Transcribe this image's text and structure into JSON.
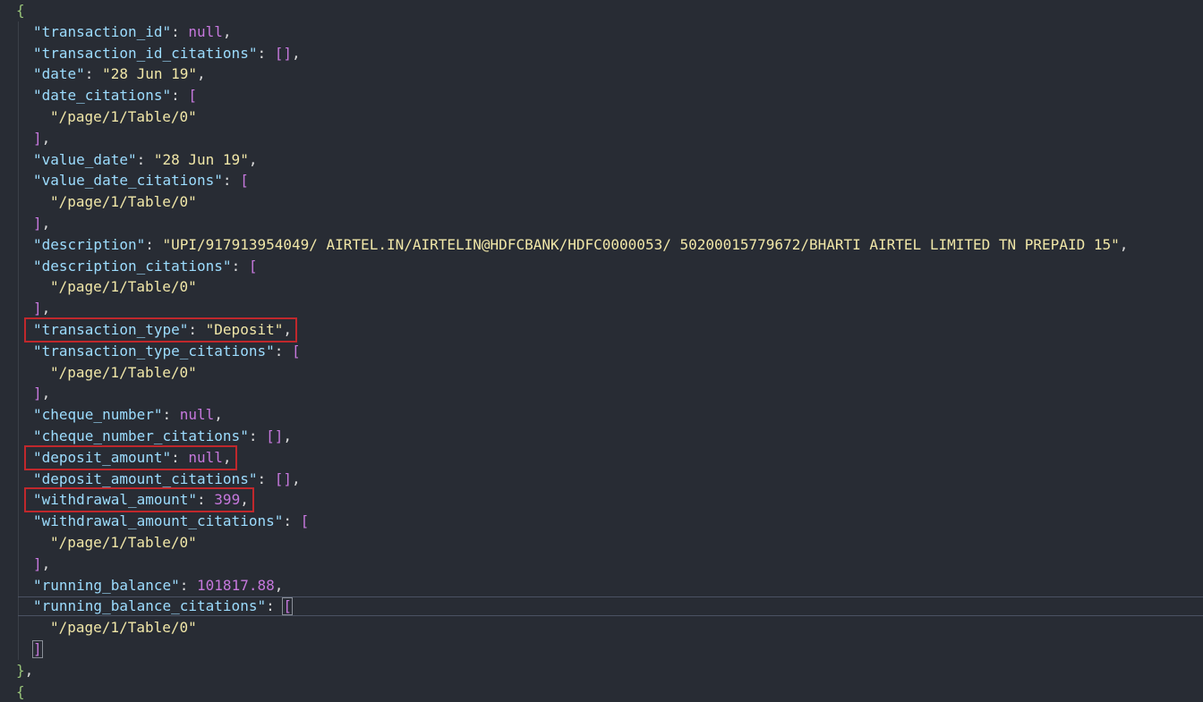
{
  "lines": [
    {
      "indent": 0,
      "tokens": [
        {
          "t": "{",
          "c": "tok-brace"
        }
      ]
    },
    {
      "indent": 1,
      "tokens": [
        {
          "t": "\"transaction_id\"",
          "c": "tok-key"
        },
        {
          "t": ": ",
          "c": "tok-punct"
        },
        {
          "t": "null",
          "c": "tok-null"
        },
        {
          "t": ",",
          "c": "tok-punct"
        }
      ]
    },
    {
      "indent": 1,
      "tokens": [
        {
          "t": "\"transaction_id_citations\"",
          "c": "tok-key"
        },
        {
          "t": ": ",
          "c": "tok-punct"
        },
        {
          "t": "[]",
          "c": "tok-bracket"
        },
        {
          "t": ",",
          "c": "tok-punct"
        }
      ]
    },
    {
      "indent": 1,
      "tokens": [
        {
          "t": "\"date\"",
          "c": "tok-key"
        },
        {
          "t": ": ",
          "c": "tok-punct"
        },
        {
          "t": "\"28 Jun 19\"",
          "c": "tok-str"
        },
        {
          "t": ",",
          "c": "tok-punct"
        }
      ]
    },
    {
      "indent": 1,
      "tokens": [
        {
          "t": "\"date_citations\"",
          "c": "tok-key"
        },
        {
          "t": ": ",
          "c": "tok-punct"
        },
        {
          "t": "[",
          "c": "tok-bracket"
        }
      ]
    },
    {
      "indent": 2,
      "tokens": [
        {
          "t": "\"/page/1/Table/0\"",
          "c": "tok-str"
        }
      ]
    },
    {
      "indent": 1,
      "tokens": [
        {
          "t": "]",
          "c": "tok-bracket"
        },
        {
          "t": ",",
          "c": "tok-punct"
        }
      ]
    },
    {
      "indent": 1,
      "tokens": [
        {
          "t": "\"value_date\"",
          "c": "tok-key"
        },
        {
          "t": ": ",
          "c": "tok-punct"
        },
        {
          "t": "\"28 Jun 19\"",
          "c": "tok-str"
        },
        {
          "t": ",",
          "c": "tok-punct"
        }
      ]
    },
    {
      "indent": 1,
      "tokens": [
        {
          "t": "\"value_date_citations\"",
          "c": "tok-key"
        },
        {
          "t": ": ",
          "c": "tok-punct"
        },
        {
          "t": "[",
          "c": "tok-bracket"
        }
      ]
    },
    {
      "indent": 2,
      "tokens": [
        {
          "t": "\"/page/1/Table/0\"",
          "c": "tok-str"
        }
      ]
    },
    {
      "indent": 1,
      "tokens": [
        {
          "t": "]",
          "c": "tok-bracket"
        },
        {
          "t": ",",
          "c": "tok-punct"
        }
      ]
    },
    {
      "indent": 1,
      "tokens": [
        {
          "t": "\"description\"",
          "c": "tok-key"
        },
        {
          "t": ": ",
          "c": "tok-punct"
        },
        {
          "t": "\"UPI/917913954049/ AIRTEL.IN/AIRTELIN@HDFCBANK/HDFC0000053/ 50200015779672/BHARTI AIRTEL LIMITED TN PREPAID 15\"",
          "c": "tok-str"
        },
        {
          "t": ",",
          "c": "tok-punct"
        }
      ]
    },
    {
      "indent": 1,
      "tokens": [
        {
          "t": "\"description_citations\"",
          "c": "tok-key"
        },
        {
          "t": ": ",
          "c": "tok-punct"
        },
        {
          "t": "[",
          "c": "tok-bracket"
        }
      ]
    },
    {
      "indent": 2,
      "tokens": [
        {
          "t": "\"/page/1/Table/0\"",
          "c": "tok-str"
        }
      ]
    },
    {
      "indent": 1,
      "tokens": [
        {
          "t": "]",
          "c": "tok-bracket"
        },
        {
          "t": ",",
          "c": "tok-punct"
        }
      ]
    },
    {
      "indent": 1,
      "tokens": [
        {
          "t": "\"transaction_type\"",
          "c": "tok-key"
        },
        {
          "t": ": ",
          "c": "tok-punct"
        },
        {
          "t": "\"Deposit\"",
          "c": "tok-str"
        },
        {
          "t": ",",
          "c": "tok-punct"
        }
      ]
    },
    {
      "indent": 1,
      "tokens": [
        {
          "t": "\"transaction_type_citations\"",
          "c": "tok-key"
        },
        {
          "t": ": ",
          "c": "tok-punct"
        },
        {
          "t": "[",
          "c": "tok-bracket"
        }
      ]
    },
    {
      "indent": 2,
      "tokens": [
        {
          "t": "\"/page/1/Table/0\"",
          "c": "tok-str"
        }
      ]
    },
    {
      "indent": 1,
      "tokens": [
        {
          "t": "]",
          "c": "tok-bracket"
        },
        {
          "t": ",",
          "c": "tok-punct"
        }
      ]
    },
    {
      "indent": 1,
      "tokens": [
        {
          "t": "\"cheque_number\"",
          "c": "tok-key"
        },
        {
          "t": ": ",
          "c": "tok-punct"
        },
        {
          "t": "null",
          "c": "tok-null"
        },
        {
          "t": ",",
          "c": "tok-punct"
        }
      ]
    },
    {
      "indent": 1,
      "tokens": [
        {
          "t": "\"cheque_number_citations\"",
          "c": "tok-key"
        },
        {
          "t": ": ",
          "c": "tok-punct"
        },
        {
          "t": "[]",
          "c": "tok-bracket"
        },
        {
          "t": ",",
          "c": "tok-punct"
        }
      ]
    },
    {
      "indent": 1,
      "tokens": [
        {
          "t": "\"deposit_amount\"",
          "c": "tok-key"
        },
        {
          "t": ": ",
          "c": "tok-punct"
        },
        {
          "t": "null",
          "c": "tok-null"
        },
        {
          "t": ",",
          "c": "tok-punct"
        }
      ]
    },
    {
      "indent": 1,
      "tokens": [
        {
          "t": "\"deposit_amount_citations\"",
          "c": "tok-key"
        },
        {
          "t": ": ",
          "c": "tok-punct"
        },
        {
          "t": "[]",
          "c": "tok-bracket"
        },
        {
          "t": ",",
          "c": "tok-punct"
        }
      ]
    },
    {
      "indent": 1,
      "tokens": [
        {
          "t": "\"withdrawal_amount\"",
          "c": "tok-key"
        },
        {
          "t": ": ",
          "c": "tok-punct"
        },
        {
          "t": "399",
          "c": "tok-num"
        },
        {
          "t": ",",
          "c": "tok-punct"
        }
      ]
    },
    {
      "indent": 1,
      "tokens": [
        {
          "t": "\"withdrawal_amount_citations\"",
          "c": "tok-key"
        },
        {
          "t": ": ",
          "c": "tok-punct"
        },
        {
          "t": "[",
          "c": "tok-bracket"
        }
      ]
    },
    {
      "indent": 2,
      "tokens": [
        {
          "t": "\"/page/1/Table/0\"",
          "c": "tok-str"
        }
      ]
    },
    {
      "indent": 1,
      "tokens": [
        {
          "t": "]",
          "c": "tok-bracket"
        },
        {
          "t": ",",
          "c": "tok-punct"
        }
      ]
    },
    {
      "indent": 1,
      "tokens": [
        {
          "t": "\"running_balance\"",
          "c": "tok-key"
        },
        {
          "t": ": ",
          "c": "tok-punct"
        },
        {
          "t": "101817.88",
          "c": "tok-num"
        },
        {
          "t": ",",
          "c": "tok-punct"
        }
      ]
    },
    {
      "indent": 1,
      "tokens": [
        {
          "t": "\"running_balance_citations\"",
          "c": "tok-key"
        },
        {
          "t": ": ",
          "c": "tok-punct"
        },
        {
          "t": "[",
          "c": "tok-bracket"
        }
      ]
    },
    {
      "indent": 2,
      "tokens": [
        {
          "t": "\"/page/1/Table/0\"",
          "c": "tok-str"
        }
      ]
    },
    {
      "indent": 1,
      "tokens": [
        {
          "t": "]",
          "c": "tok-bracket"
        }
      ]
    },
    {
      "indent": 0,
      "tokens": [
        {
          "t": "}",
          "c": "tok-brace"
        },
        {
          "t": ",",
          "c": "tok-punct"
        }
      ]
    },
    {
      "indent": 0,
      "tokens": [
        {
          "t": "{",
          "c": "tok-brace"
        }
      ]
    }
  ],
  "highlighted_lines": [
    15,
    21,
    23
  ],
  "cursor_line": 28,
  "colors": {
    "background": "#282c34",
    "key": "#9cdcfe",
    "string": "#f1e7a8",
    "keyword": "#c678dd",
    "brace": "#98c379",
    "highlight_box": "#c0282c"
  }
}
